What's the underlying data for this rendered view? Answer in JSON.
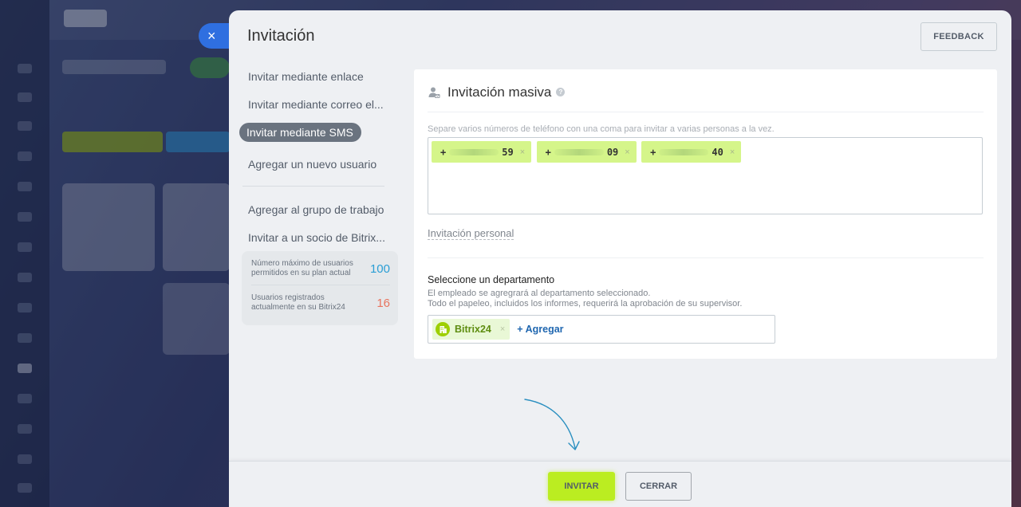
{
  "background_app": {
    "description_hidden": ""
  },
  "slider": {
    "title": "Invitación",
    "close_icon": "×",
    "feedback_label": "FEEDBACK"
  },
  "menu": {
    "items": [
      {
        "label": "Invitar mediante enlace"
      },
      {
        "label": "Invitar mediante correo el..."
      },
      {
        "label": "Invitar mediante SMS",
        "active": true
      },
      {
        "label": "Agregar un nuevo usuario"
      },
      {
        "label": "Agregar al grupo de trabajo"
      },
      {
        "label": "Invitar a un socio de Bitrix..."
      }
    ],
    "stats": [
      {
        "label": "Número máximo de usuarios permitidos en su plan actual",
        "value": "100",
        "color": "#2a9ed5"
      },
      {
        "label": "Usuarios registrados actualmente en su Bitrix24",
        "value": "16",
        "color": "#e8745e"
      }
    ]
  },
  "card": {
    "title": "Invitación masiva",
    "help_icon": "?",
    "hint": "Separe varios números de teléfono con una coma para invitar a varias personas a la vez.",
    "phones": [
      {
        "prefix": "+",
        "suffix": "59"
      },
      {
        "prefix": "+",
        "suffix": "09"
      },
      {
        "prefix": "+",
        "suffix": "40"
      }
    ],
    "tag_remove_icon": "×",
    "personal_link": "Invitación personal",
    "department": {
      "title": "Seleccione un departamento",
      "desc_line1": "El empleado se agregrará al departamento seleccionado.",
      "desc_line2": "Todo el papeleo, incluidos los informes, requerirá la aprobación de su supervisor.",
      "selected": "Bitrix24",
      "add_label": "+ Agregar"
    }
  },
  "footer": {
    "invite_label": "INVITAR",
    "close_label": "CERRAR"
  },
  "colors": {
    "accent_green": "#bbed21",
    "phone_tag": "#d5f58a",
    "active_menu": "#6a737f",
    "link_blue": "#2067b0"
  }
}
